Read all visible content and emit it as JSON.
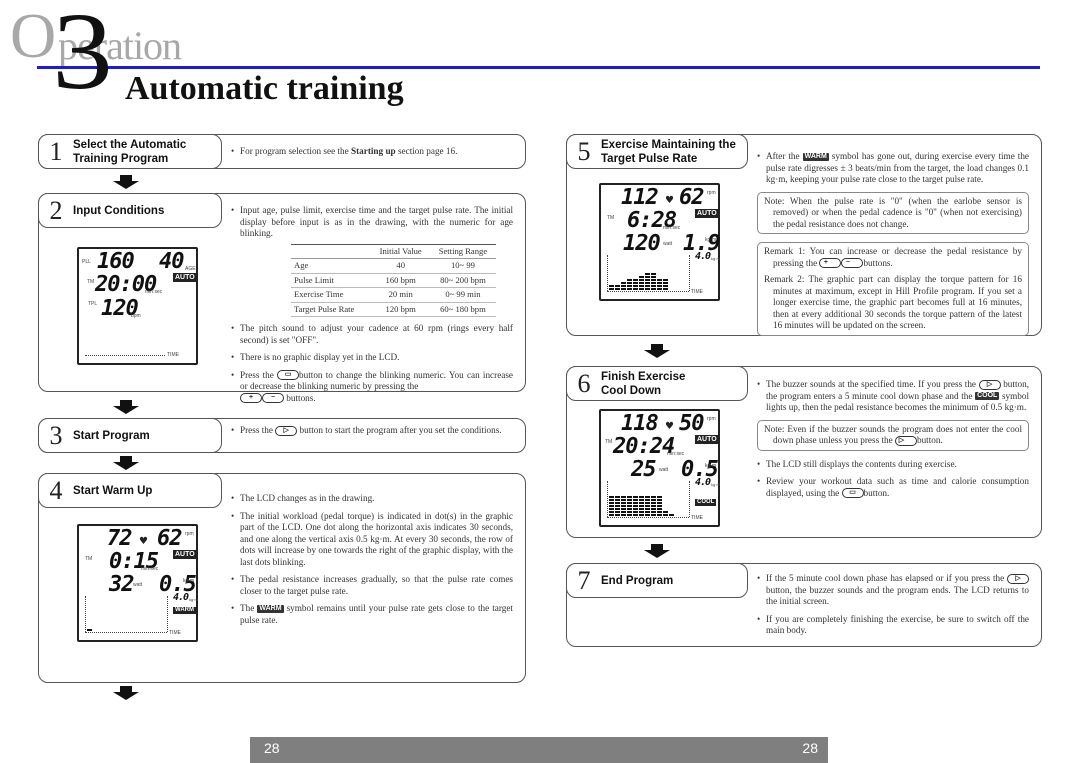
{
  "header": {
    "section_word_initial": "O",
    "section_word_rest": "peration",
    "chapter_number": "3",
    "title": "Automatic training",
    "rule_color": "#1a1ae0"
  },
  "steps": [
    {
      "number": "1",
      "title_lines": [
        "Select the Automatic",
        "Training Program"
      ],
      "bullets": [
        {
          "pre": "For program selection see the ",
          "bold": "Starting up",
          "post": " section page 16."
        }
      ]
    },
    {
      "number": "2",
      "title_lines": [
        "Input Conditions"
      ],
      "intro": "Input age, pulse limit, exercise time and the target pulse rate. The initial display before input is as in the drawing, with the numeric for age blinking.",
      "table": {
        "headers": [
          "",
          "Initial Value",
          "Setting Range"
        ],
        "rows": [
          [
            "Age",
            "40",
            "10~  99"
          ],
          [
            "Pulse Limit",
            "160 bpm",
            "80~ 200 bpm"
          ],
          [
            "Exercise Time",
            "20 min",
            "0~  99 min"
          ],
          [
            "Target Pulse Rate",
            "120 bpm",
            "60~ 180 bpm"
          ]
        ]
      },
      "bullets": [
        "The pitch sound to adjust your cadence at 60 rpm (rings every half second) is set \"OFF\".",
        "There is no graphic display yet in the LCD."
      ],
      "press_bullet": {
        "pre": "Press the ",
        "mid": "button to change the blinking numeric. You can increase or decrease the blinking numeric by pressing the",
        "post": " buttons."
      },
      "lcd": {
        "pll_label": "PLL",
        "pll_value": "160",
        "age_value": "40",
        "age_label": "AGE",
        "auto_label": "AUTO",
        "tm_label": "TM",
        "tm_value": "20:00",
        "tm_unit": "min:sec",
        "tpl_label": "TPL",
        "tpl_value": "120",
        "tpl_unit": "bpm",
        "time_label": "TIME"
      }
    },
    {
      "number": "3",
      "title_lines": [
        "Start Program"
      ],
      "bullet": {
        "pre": "Press the ",
        "post": " button to start the program after you set the conditions."
      }
    },
    {
      "number": "4",
      "title_lines": [
        "Start Warm Up"
      ],
      "bullets": [
        "The LCD changes as in the drawing.",
        "The initial workload (pedal torque) is indicated in dot(s) in the graphic part of the LCD. One dot along the horizontal axis indicates 30 seconds, and one along the vertical axis 0.5 kg·m. At every 30 seconds, the row of dots will increase by one towards the right of the graphic display, with the last dots blinking.",
        "The pedal resistance increases gradually, so that the pulse rate comes closer to the target pulse rate."
      ],
      "warm_bullet": {
        "pre": "The ",
        "badge": "WARM",
        "post": " symbol remains until your pulse rate gets close to the target pulse rate."
      },
      "lcd": {
        "pulse": "72",
        "rpm": "62",
        "rpm_unit": "rpm",
        "auto_label": "AUTO",
        "tm_label": "TM",
        "tm_value": "0:15",
        "tm_unit": "min:sec",
        "watt": "32",
        "watt_unit": "watt",
        "kgm": "0.5",
        "kgm_unit": "kg·m",
        "scale": "4.0",
        "scale_unit": "kg·m",
        "mode_badge": "WARM",
        "time_label": "TIME",
        "torque_bars": [
          1
        ]
      }
    },
    {
      "number": "5",
      "title_lines": [
        "Exercise Maintaining the",
        "Target Pulse Rate"
      ],
      "warm_bullet": {
        "pre": "After the ",
        "badge": "WARM",
        "post": " symbol has gone out, during exercise every time the pulse rate digresses ± 3 beats/min from the target, the load changes 0.1 kg·m, keeping your pulse rate close to the target pulse rate."
      },
      "note": "Note: When the pulse rate is \"0\" (when the earlobe sensor is removed) or when the pedal cadence is \"0\" (when not exercising) the pedal resistance does not change.",
      "remark1_pre": "Remark 1: You can increase or decrease the pedal resistance by pressing the ",
      "remark1_post": "buttons.",
      "remark2": "Remark 2: The graphic part can display the torque pattern for 16 minutes at maximum, except in Hill Profile program.  If you set a longer exercise time, the graphic part  becomes full at 16 minutes, then at every additional 30 seconds the torque pattern of the latest 16 minutes will be updated on the screen.",
      "lcd": {
        "pulse": "112",
        "rpm": "62",
        "rpm_unit": "rpm",
        "auto_label": "AUTO",
        "tm_label": "TM",
        "tm_value": "6:28",
        "tm_unit": "min:sec",
        "watt": "120",
        "watt_unit": "watt",
        "kgm": "1.9",
        "kgm_unit": "kg·m",
        "scale": "4.0",
        "scale_unit": "kg·m",
        "time_label": "TIME",
        "torque_bars": [
          2,
          2,
          3,
          4,
          4,
          5,
          6,
          6,
          4,
          4
        ]
      }
    },
    {
      "number": "6",
      "title_lines": [
        "Finish Exercise",
        "Cool Down"
      ],
      "bullet1": {
        "pre": "The buzzer sounds at the specified time. If you press the ",
        "mid": " button, the program enters a 5 minute cool down phase and the ",
        "badge": "COOL",
        "post": " symbol lights up, then the pedal resistance becomes the minimum of 0.5 kg·m."
      },
      "note": {
        "pre": "Note: Even if the buzzer sounds the program does not enter the cool down phase unless you press the ",
        "post": "button."
      },
      "bullet2": "The LCD still displays the contents during exercise.",
      "bullet3": {
        "pre": "Review your workout data such as time and calorie consumption displayed, using the ",
        "post": "button."
      },
      "lcd": {
        "pulse": "118",
        "rpm": "50",
        "rpm_unit": "rpm",
        "auto_label": "AUTO",
        "tm_label": "TM",
        "tm_value": "20:24",
        "tm_unit": "min:sec",
        "watt": "25",
        "watt_unit": "watt",
        "kgm": "0.5",
        "kgm_unit": "kg·m",
        "scale": "4.0",
        "scale_unit": "kg·m",
        "mode_badge": "COOL",
        "time_label": "TIME",
        "torque_bars": [
          7,
          7,
          7,
          7,
          7,
          7,
          7,
          7,
          7,
          2,
          1
        ]
      }
    },
    {
      "number": "7",
      "title_lines": [
        "End Program"
      ],
      "bullet1": {
        "pre": "If the 5 minute cool down phase has elapsed or if you press the ",
        "post": " button, the buzzer sounds and the program ends. The LCD returns to the initial screen."
      },
      "bullet2": "If you are completely finishing the exercise, be sure to switch off the main body."
    }
  ],
  "buttons": {
    "plus": "+",
    "minus": "−",
    "start": "▷",
    "mode": "▭"
  },
  "footer": {
    "page_left": "28",
    "page_right": "28",
    "bar_color": "#7f7f7f"
  }
}
